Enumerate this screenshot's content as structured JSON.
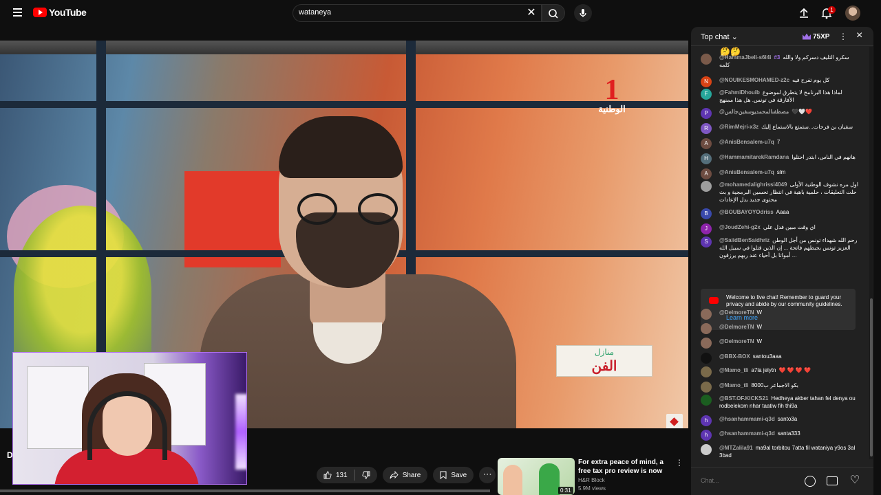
{
  "header": {
    "logo_text": "YouTube",
    "search_value": "wataneya",
    "clear_symbol": "✕",
    "notification_count": "1",
    "icons": [
      "menu-icon",
      "search-icon",
      "mic-icon",
      "upload-icon",
      "bell-icon",
      "avatar"
    ]
  },
  "video": {
    "channel_logo_number": "1",
    "channel_logo_name": "الوطنية",
    "show_logo_line1": "منازل",
    "show_logo_line2": "الفن",
    "title_peek": "D"
  },
  "actions": {
    "like_count": "131",
    "share_label": "Share",
    "save_label": "Save",
    "more_symbol": "⋯"
  },
  "ad": {
    "title": "For extra peace of mind, a free tax pro review is now included...",
    "channel": "H&R Block",
    "views": "5.9M views",
    "duration": "0:31"
  },
  "chat": {
    "mode_label": "Top chat",
    "xp_label": "75XP",
    "top_emoji": "🤔🤔",
    "welcome_text": "Welcome to live chat! Remember to guard your privacy and abide by our community guidelines.",
    "learn_more": "Learn more",
    "input_placeholder": "Chat...",
    "messages": [
      {
        "author": "@HammaJbeli-s6l4i",
        "rank": "#3",
        "text": "سكرو التليف دسركم ولا والله كلمه"
      },
      {
        "author": "@NOUIKESMOHAMED-z2c",
        "text": "كل يوم تفرح فيه"
      },
      {
        "author": "@FahmiDhouib",
        "text": "لماذا هذا البرنامج لا يتطرق لموضوع الأفارقة في تونس. هل هذا ممنهج"
      },
      {
        "author": "@مصطفىالمحمديوسفبن‌جالس",
        "text": "🖤🤍❤️"
      },
      {
        "author": "@RimMejri-x3z",
        "text": "سفيان بن فرحات...ستمتع بالاستماع إليك"
      },
      {
        "author": "@AnisBensalem-u7q",
        "text": "7"
      },
      {
        "author": "@HammamitarekRamdana",
        "text": "هانهم في الناس، ابتدر احتلوا"
      },
      {
        "author": "@AnisBensalem-u7q",
        "text": "slm"
      },
      {
        "author": "@mohamedalighrissi4049",
        "text": "اول مره نشوف الوطنية الأولى حلت التعليقات ، حلمية باهية في انتظار تحسين البرمجية و بث محتوى جديد بدل الإعادات"
      },
      {
        "author": "@BOUBAYOYOdriss",
        "text": "Aaaa"
      },
      {
        "author": "@JoudZehi-g2x",
        "text": "اي وقت مبين فدل علي"
      },
      {
        "author": "@SaiidBenSaidhriz",
        "text": "رحم الله شهداء تونس من أجل الوطن العزيز تونس بحبطهم فاتحة ... إن الذين قتلوا في سبيل الله أمواتا بل أحياء عند ربهم يرزقون ..."
      },
      {
        "author": "@DelmoreTN",
        "text": "W"
      },
      {
        "author": "@DelmoreTN",
        "text": "W"
      },
      {
        "author": "@DelmoreTN",
        "text": "W"
      },
      {
        "author": "@BBX-BOX",
        "text": "santou3aaa"
      },
      {
        "author": "@Mamo_tli",
        "text": "a7la jelytn",
        "hearts": "❤️ ❤️ ❤️ ❤️"
      },
      {
        "author": "@Mamo_tli",
        "text": "بكو الاجماعر ب8000"
      },
      {
        "author": "@BST.OF.KICKS21",
        "text": "Hedheya akber tahan fel denya ou rodbelekom nhar taatiw fih thi9a"
      },
      {
        "author": "@hsanhammami-q3d",
        "text": "santo3a"
      },
      {
        "author": "@hsanhammami-q3d",
        "text": "santa333"
      },
      {
        "author": "@MTZalila91",
        "text": "ma9al torbitou 7atta fil wataniya y9os 3al 3bad"
      }
    ],
    "avatar_letters": [
      "",
      "N",
      "F",
      "P",
      "R",
      "A",
      "H",
      "A",
      "",
      "B",
      "J",
      "S",
      "",
      "",
      "",
      "",
      "",
      "",
      "",
      "h",
      "h",
      ""
    ],
    "avatar_colors": [
      "#7a5a4a",
      "#d84315",
      "#26a69a",
      "#5e35b1",
      "#7e57c2",
      "#6d4c41",
      "#546e7a",
      "#6d4c41",
      "#9e9e9e",
      "#3949ab",
      "#8e24aa",
      "#5e35b1",
      "#8a6a5a",
      "#8a6a5a",
      "#8a6a5a",
      "#111111",
      "#7a6a4a",
      "#7a6a4a",
      "#1b5e20",
      "#5e35b1",
      "#5e35b1",
      "#cccccc"
    ]
  }
}
